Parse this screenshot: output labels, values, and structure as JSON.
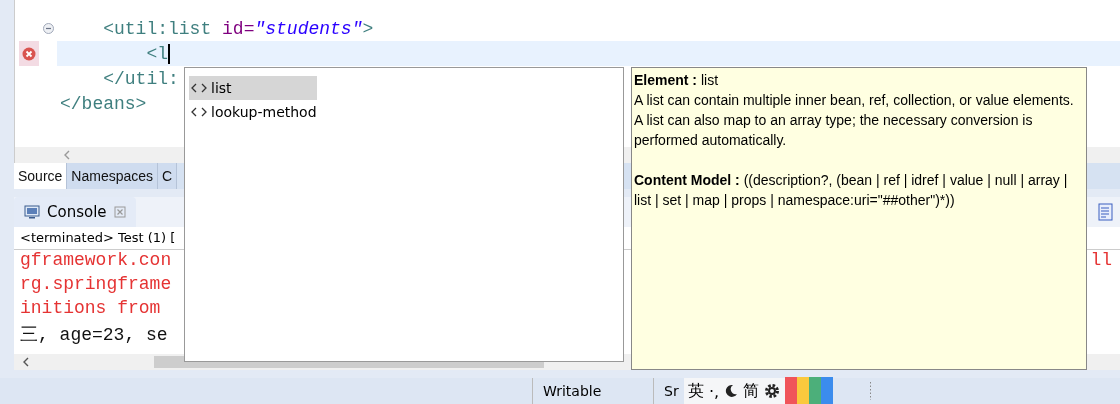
{
  "editor": {
    "lines": [
      {
        "text_parts": [
          {
            "kind": "tag",
            "text": "    <util:list "
          },
          {
            "kind": "attr",
            "text": "id="
          },
          {
            "kind": "value",
            "text": "\"students\""
          },
          {
            "kind": "tag",
            "text": ">"
          }
        ],
        "fold": true,
        "error": false,
        "current": false
      },
      {
        "text_parts": [
          {
            "kind": "tag",
            "text": "        <l"
          }
        ],
        "fold": false,
        "error": true,
        "current": true
      },
      {
        "text_parts": [
          {
            "kind": "tag",
            "text": "    </util:"
          }
        ],
        "fold": false,
        "error": false,
        "current": false
      },
      {
        "text_parts": [
          {
            "kind": "tag",
            "text": "</beans>"
          }
        ],
        "fold": false,
        "error": false,
        "current": false
      }
    ]
  },
  "editor_tabs": [
    {
      "label": "Source",
      "selected": true
    },
    {
      "label": "Namespaces",
      "selected": false
    },
    {
      "label": "C",
      "selected": false
    }
  ],
  "console": {
    "title": "Console",
    "status": "<terminated> Test (1) [",
    "lines": [
      {
        "kind": "error",
        "text": "gframework.con",
        "tail": "ll"
      },
      {
        "kind": "error",
        "text": "rg.springframe"
      },
      {
        "kind": "error",
        "text": "initions from"
      },
      {
        "kind": "normal",
        "text": "三, age=23, se"
      }
    ]
  },
  "completion": {
    "items": [
      {
        "label": "list",
        "selected": true
      },
      {
        "label": "lookup-method",
        "selected": false
      }
    ]
  },
  "info": {
    "heading": "**Element :** list",
    "description": "A list can contain multiple inner bean, ref, collection, or value elements. A list can also map to an array type; the necessary conversion is performed automatically.",
    "content_model": "**Content Model :** ((description?, (bean | ref | idref | value | null | array | list | set | map | props | namespace:uri=\"##other\")*))"
  },
  "status_bar": {
    "mode": "Writable",
    "insert": "Sr",
    "ime": {
      "lang": "英",
      "punct": "·,",
      "script": "简"
    }
  }
}
